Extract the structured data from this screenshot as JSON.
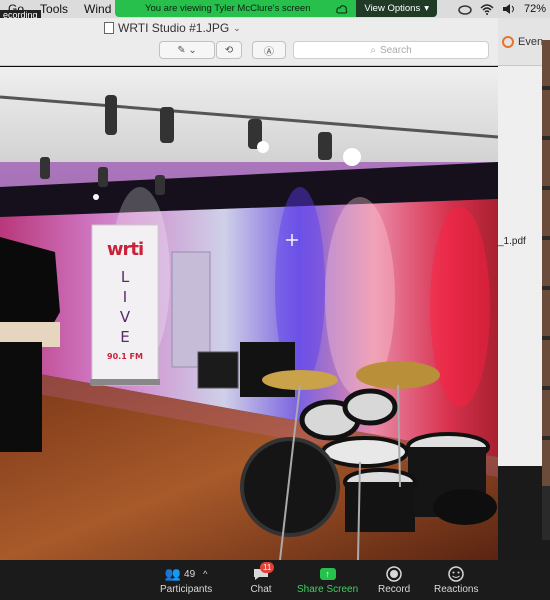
{
  "menubar": {
    "items": [
      "Go",
      "Tools",
      "Wind"
    ],
    "recording_label": "ecording",
    "battery": "72%"
  },
  "banner": {
    "text": "You are viewing Tyler  McClure's screen",
    "view_options": "View Options"
  },
  "preview": {
    "title": "WRTI Studio #1.JPG",
    "search_placeholder": "Search"
  },
  "photo": {
    "banner_brand": "wrti",
    "banner_freq_top": "90.1 FM",
    "banner_word": "LIVE",
    "banner_freq": "90.1 FM"
  },
  "side": {
    "header": "Even",
    "file": "_1.pdf"
  },
  "zoom": {
    "participants_count": "49",
    "participants_label": "Participants",
    "chat_label": "Chat",
    "chat_badge": "11",
    "share_label": "Share Screen",
    "record_label": "Record",
    "reactions_label": "Reactions"
  },
  "colors": {
    "banner_green": "#27c04c",
    "accent_red": "#e5413a"
  }
}
